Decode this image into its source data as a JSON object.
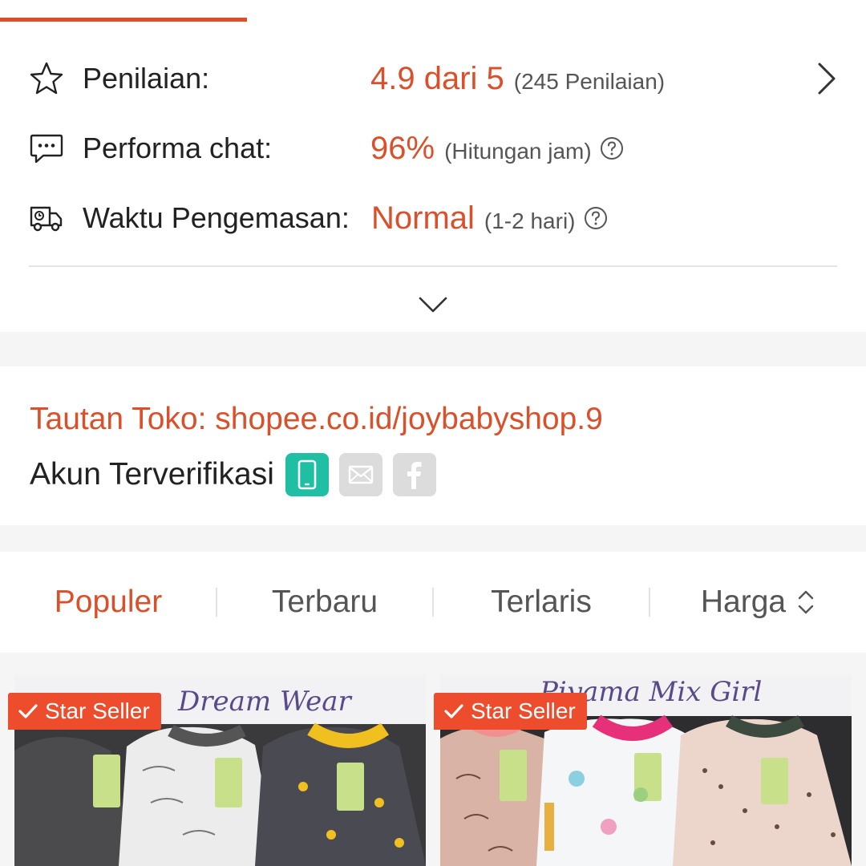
{
  "stats": {
    "rating": {
      "label": "Penilaian:",
      "value": "4.9 dari 5",
      "detail": "(245 Penilaian)"
    },
    "chat": {
      "label": "Performa chat:",
      "value": "96%",
      "detail": "(Hitungan jam)"
    },
    "packing": {
      "label": "Waktu Pengemasan:",
      "value": "Normal",
      "detail": "(1-2 hari)"
    }
  },
  "shop": {
    "link_text": "Tautan Toko: shopee.co.id/joybabyshop.9",
    "verified_label": "Akun Terverifikasi",
    "badges": [
      "phone-icon",
      "mail-icon",
      "facebook-icon"
    ]
  },
  "sort": {
    "tabs": [
      {
        "label": "Populer",
        "active": true
      },
      {
        "label": "Terbaru",
        "active": false
      },
      {
        "label": "Terlaris",
        "active": false
      },
      {
        "label": "Harga",
        "active": false
      }
    ]
  },
  "products": [
    {
      "caption": "Dream Wear",
      "badge": "Star Seller"
    },
    {
      "caption": "Piyama Mix Girl",
      "badge": "Star Seller"
    }
  ],
  "colors": {
    "accent": "#d9502a",
    "badge_orange": "#ee4d2d",
    "verified_teal": "#1fbfa3"
  }
}
